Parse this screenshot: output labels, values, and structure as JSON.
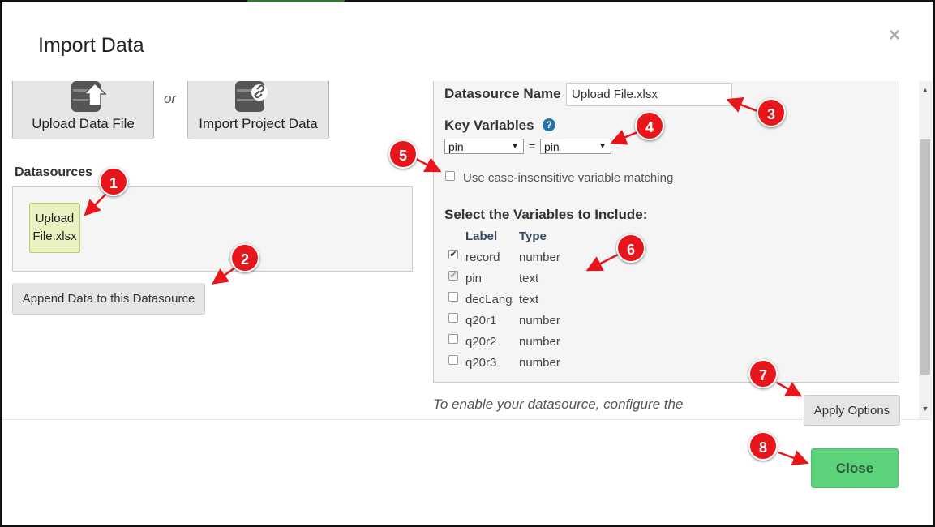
{
  "dialog": {
    "title": "Import Data",
    "close_x": "×"
  },
  "sources": {
    "upload_label": "Upload Data File",
    "or_label": "or",
    "project_label": "Import Project Data"
  },
  "datasources": {
    "heading": "Datasources",
    "items": [
      {
        "label_line1": "Upload",
        "label_line2": "File.xlsx"
      }
    ],
    "append_label": "Append Data to this Datasource"
  },
  "options": {
    "name_label": "Datasource Name",
    "name_value": "Upload File.xlsx",
    "key_label": "Key Variables",
    "help_glyph": "?",
    "key_left": "pin",
    "key_equals": "=",
    "key_right": "pin",
    "case_label": "Use case-insensitive variable matching",
    "select_heading": "Select the Variables to Include:",
    "col_label": "Label",
    "col_type": "Type",
    "variables": [
      {
        "label": "record",
        "type": "number",
        "checked": true,
        "disabled": false
      },
      {
        "label": "pin",
        "type": "text",
        "checked": true,
        "disabled": true
      },
      {
        "label": "decLang",
        "type": "text",
        "checked": false,
        "disabled": false
      },
      {
        "label": "q20r1",
        "type": "number",
        "checked": false,
        "disabled": false
      },
      {
        "label": "q20r2",
        "type": "number",
        "checked": false,
        "disabled": false
      },
      {
        "label": "q20r3",
        "type": "number",
        "checked": false,
        "disabled": false
      }
    ],
    "hint_text": "To enable your datasource, configure the",
    "apply_label": "Apply Options"
  },
  "footer": {
    "close_label": "Close"
  },
  "callouts": [
    "1",
    "2",
    "3",
    "4",
    "5",
    "6",
    "7",
    "8"
  ],
  "colors": {
    "badge": "#e8151b",
    "close_button": "#5cd37a",
    "help_icon": "#2574a9"
  }
}
